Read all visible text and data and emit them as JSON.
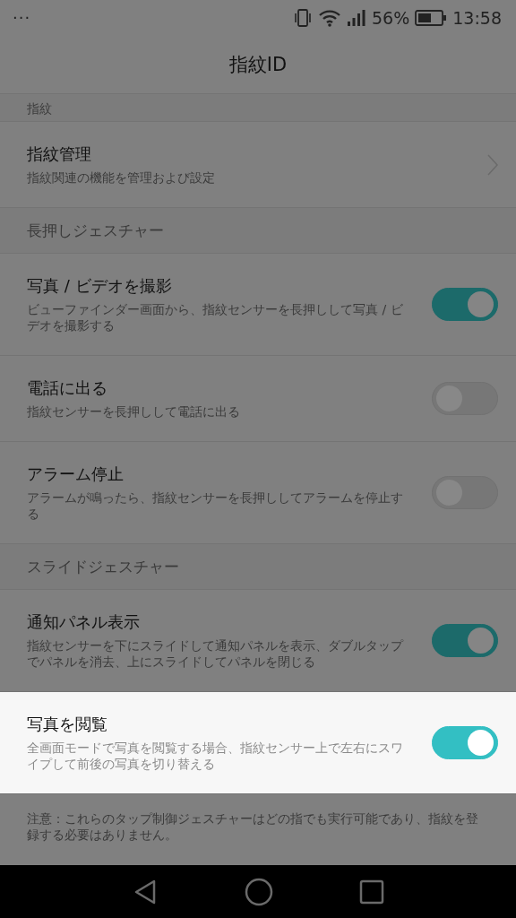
{
  "status_bar": {
    "menu": "···",
    "battery": "56%",
    "time": "13:58"
  },
  "title": "指紋ID",
  "items": [
    {
      "kind": "partial",
      "title": "指紋"
    },
    {
      "kind": "link",
      "title": "指紋管理",
      "subtitle": "指紋関連の機能を管理および設定"
    },
    {
      "kind": "section",
      "title": "長押しジェスチャー"
    },
    {
      "kind": "toggle",
      "title": "写真 / ビデオを撮影",
      "subtitle": "ビューファインダー画面から、指紋センサーを長押しして写真 / ビデオを撮影する",
      "on": true,
      "highlighted": false
    },
    {
      "kind": "toggle",
      "title": "電話に出る",
      "subtitle": "指紋センサーを長押しして電話に出る",
      "on": false,
      "highlighted": false
    },
    {
      "kind": "toggle",
      "title": "アラーム停止",
      "subtitle": "アラームが鳴ったら、指紋センサーを長押ししてアラームを停止する",
      "on": false,
      "highlighted": false
    },
    {
      "kind": "section",
      "title": "スライドジェスチャー"
    },
    {
      "kind": "toggle",
      "title": "通知パネル表示",
      "subtitle": "指紋センサーを下にスライドして通知パネルを表示、ダブルタップでパネルを消去、上にスライドしてパネルを閉じる",
      "on": true,
      "highlighted": false
    },
    {
      "kind": "toggle",
      "title": "写真を閲覧",
      "subtitle": "全画面モードで写真を閲覧する場合、指紋センサー上で左右にスワイプして前後の写真を切り替える",
      "on": true,
      "highlighted": true
    },
    {
      "kind": "note",
      "title": "注意：これらのタップ制御ジェスチャーはどの指でも実行可能であり、指紋を登録する必要はありません。"
    }
  ]
}
